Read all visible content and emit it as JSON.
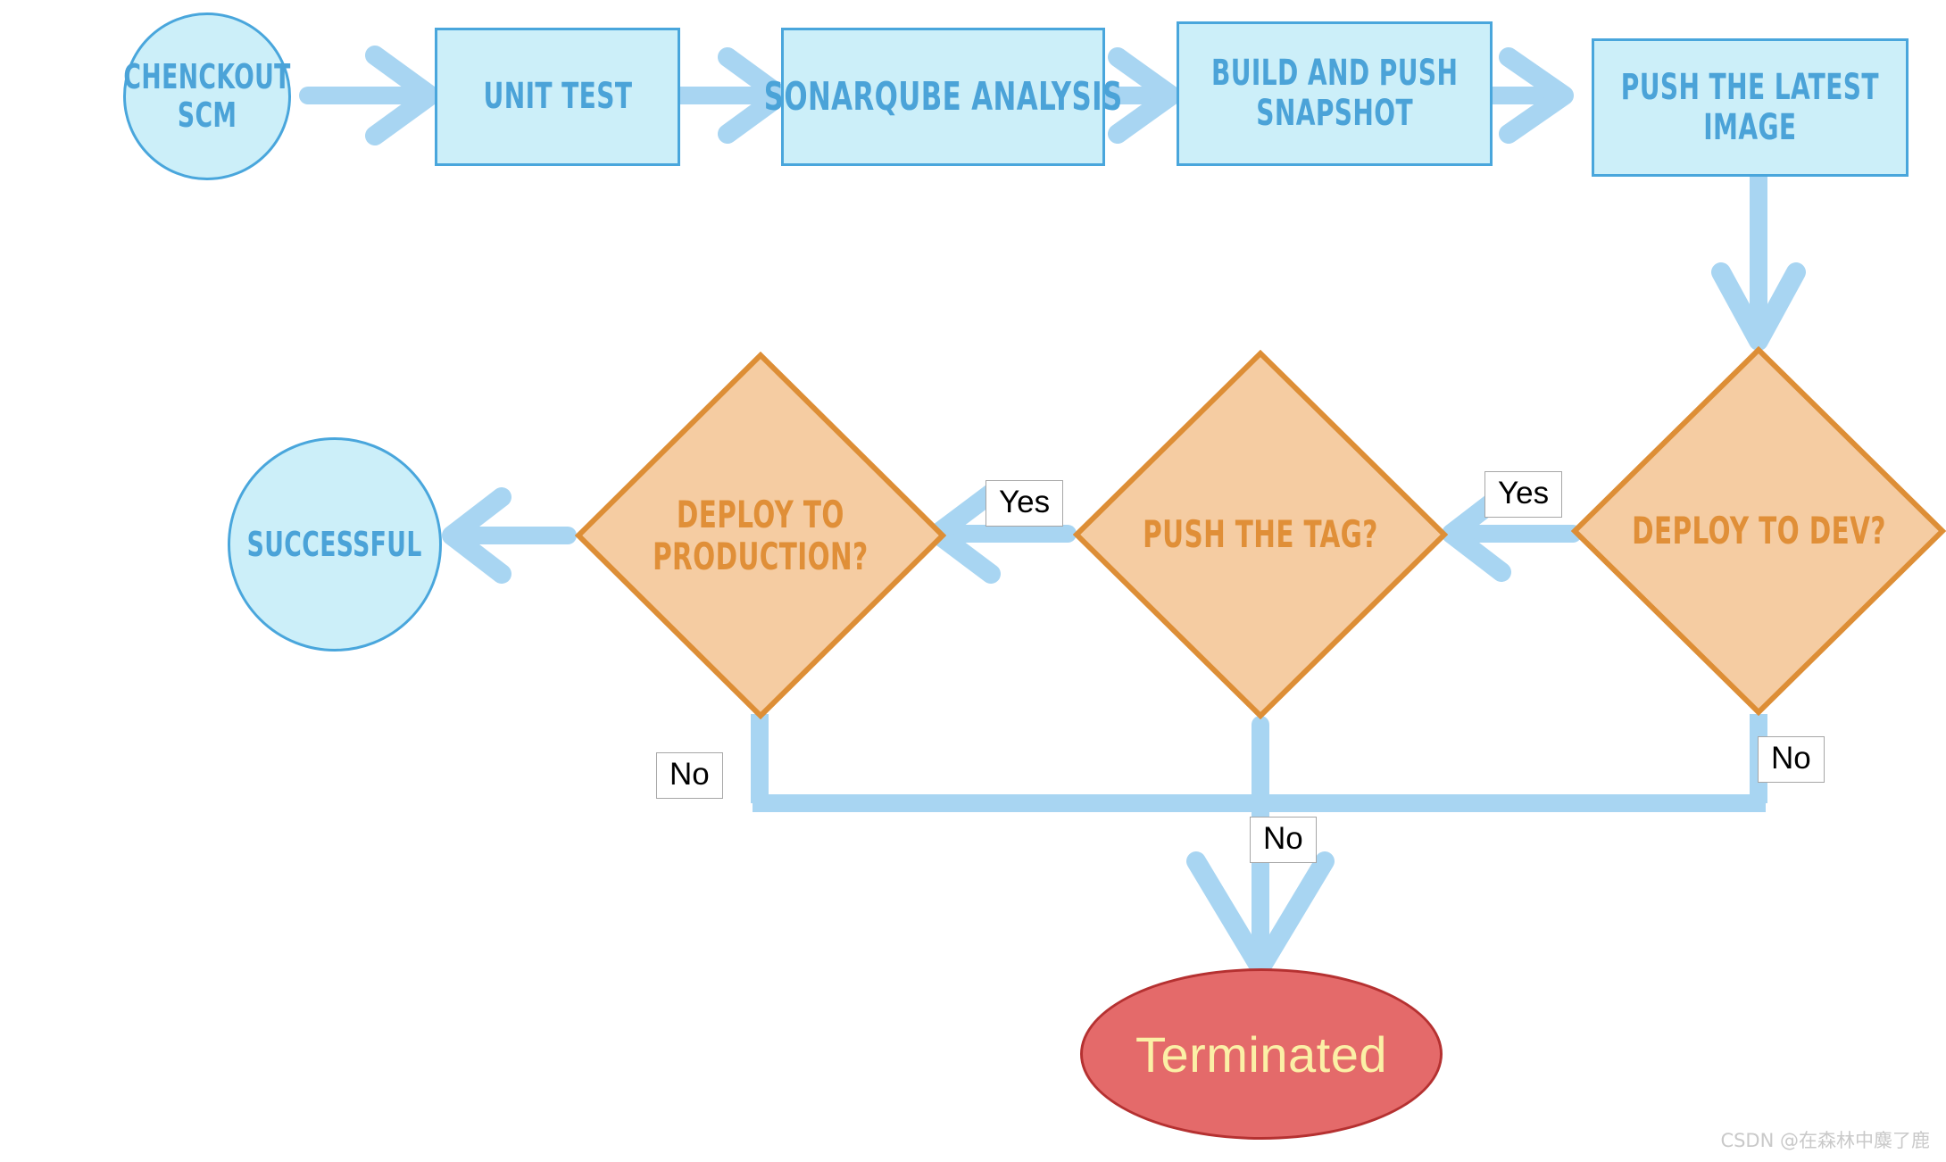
{
  "diagram": {
    "title": "CI/CD Pipeline Flowchart",
    "colors": {
      "process_fill": "#CCEFF9",
      "process_border": "#49A6DC",
      "process_text": "#4BA3D8",
      "decision_fill": "#F5CCA2",
      "decision_border": "#DD8E36",
      "decision_text": "#E08F38",
      "arrow": "#A8D5F2",
      "terminal_fill": "#E46A6A",
      "terminal_border": "#B53131",
      "terminal_text": "#FBF0A6",
      "label_border": "#A6A6A6",
      "background": "#FFFFFF"
    },
    "nodes": {
      "checkout_scm": {
        "label_line1": "CHENCKOUT",
        "label_line2": "SCM",
        "shape": "circle"
      },
      "unit_test": {
        "label": "UNIT TEST",
        "shape": "rectangle"
      },
      "sonarqube": {
        "label": "SONARQUBE ANALYSIS",
        "shape": "rectangle"
      },
      "build_push": {
        "label_line1": "BUILD AND PUSH",
        "label_line2": "SNAPSHOT",
        "shape": "rectangle"
      },
      "push_latest": {
        "label_line1": "PUSH THE LATEST",
        "label_line2": "IMAGE",
        "shape": "rectangle"
      },
      "deploy_dev": {
        "label": "DEPLOY TO DEV?",
        "shape": "diamond"
      },
      "push_tag": {
        "label": "PUSH THE TAG?",
        "shape": "diamond"
      },
      "deploy_prod": {
        "label_line1": "DEPLOY TO",
        "label_line2": "PRODUCTION?",
        "shape": "diamond"
      },
      "successful": {
        "label": "SUCCESSFUL",
        "shape": "circle"
      },
      "terminated": {
        "label": "Terminated",
        "shape": "ellipse"
      }
    },
    "edge_labels": {
      "dev_yes": "Yes",
      "dev_no": "No",
      "tag_yes": "Yes",
      "tag_no": "No",
      "prod_no": "No"
    },
    "watermark": "CSDN @在森林中麋了鹿"
  }
}
